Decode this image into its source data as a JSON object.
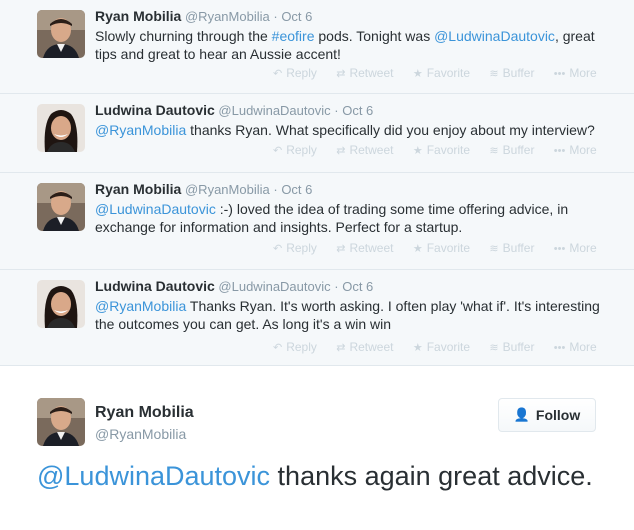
{
  "thread": [
    {
      "fullname": "Ryan Mobilia",
      "username": "@RyanMobilia",
      "separator": "·",
      "time": "Oct 6",
      "text_parts": {
        "a": "Slowly churning through the ",
        "b": "#eofire",
        "c": " pods. Tonight was ",
        "d": "@LudwinaDautovic",
        "e": ", great tips and great to hear an Aussie accent!"
      },
      "avatar": "ryan"
    },
    {
      "fullname": "Ludwina Dautovic",
      "username": "@LudwinaDautovic",
      "separator": "·",
      "time": "Oct 6",
      "text_parts": {
        "a": "@RyanMobilia",
        "b": " thanks Ryan. What specifically did you enjoy about my interview?"
      },
      "avatar": "ludwina"
    },
    {
      "fullname": "Ryan Mobilia",
      "username": "@RyanMobilia",
      "separator": "·",
      "time": "Oct 6",
      "text_parts": {
        "a": "@LudwinaDautovic",
        "b": " :-) loved the idea of trading some time offering advice, in exchange for information and insights. Perfect for a startup."
      },
      "avatar": "ryan"
    },
    {
      "fullname": "Ludwina Dautovic",
      "username": "@LudwinaDautovic",
      "separator": "·",
      "time": "Oct 6",
      "text_parts": {
        "a": "@RyanMobilia",
        "b": " Thanks Ryan. It's worth asking. I often play 'what if'. It's interesting the outcomes you can get. As long it's a win win"
      },
      "avatar": "ludwina"
    }
  ],
  "actions": {
    "reply": "Reply",
    "retweet": "Retweet",
    "favorite": "Favorite",
    "buffer": "Buffer",
    "more": "More"
  },
  "icons": {
    "reply": "reply-icon",
    "retweet": "retweet-icon",
    "favorite": "star-icon",
    "buffer": "buffer-icon",
    "more": "more-dots-icon",
    "follow": "add-user-icon"
  },
  "main_tweet": {
    "fullname": "Ryan Mobilia",
    "username": "@RyanMobilia",
    "follow_label": "Follow",
    "mention": "@LudwinaDautovic",
    "text": " thanks again great advice."
  },
  "colors": {
    "link": "#3b94d9",
    "action": "#ccd6dd",
    "thread_bg": "#f5f8fa"
  }
}
